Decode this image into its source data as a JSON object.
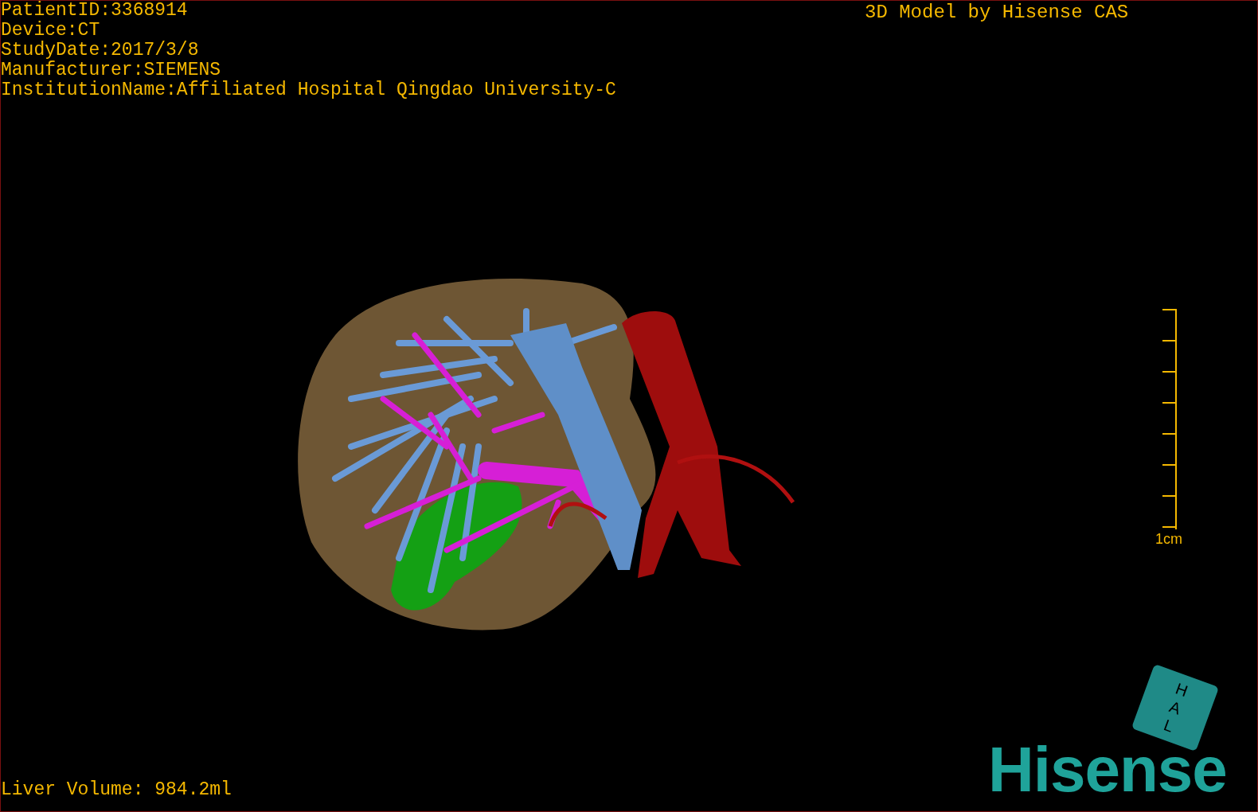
{
  "info_lines": [
    "PatientID:3368914",
    "Device:CT",
    "StudyDate:2017/3/8",
    "Manufacturer:SIEMENS",
    "InstitutionName:Affiliated Hospital Qingdao University-C"
  ],
  "title": "3D Model by Hisense CAS",
  "scale_bar": {
    "label": "1cm"
  },
  "liver_volume": "Liver Volume: 984.2ml",
  "orientation_cube": {
    "faces": [
      "H",
      "A",
      "L"
    ]
  },
  "logo": "Hisense"
}
